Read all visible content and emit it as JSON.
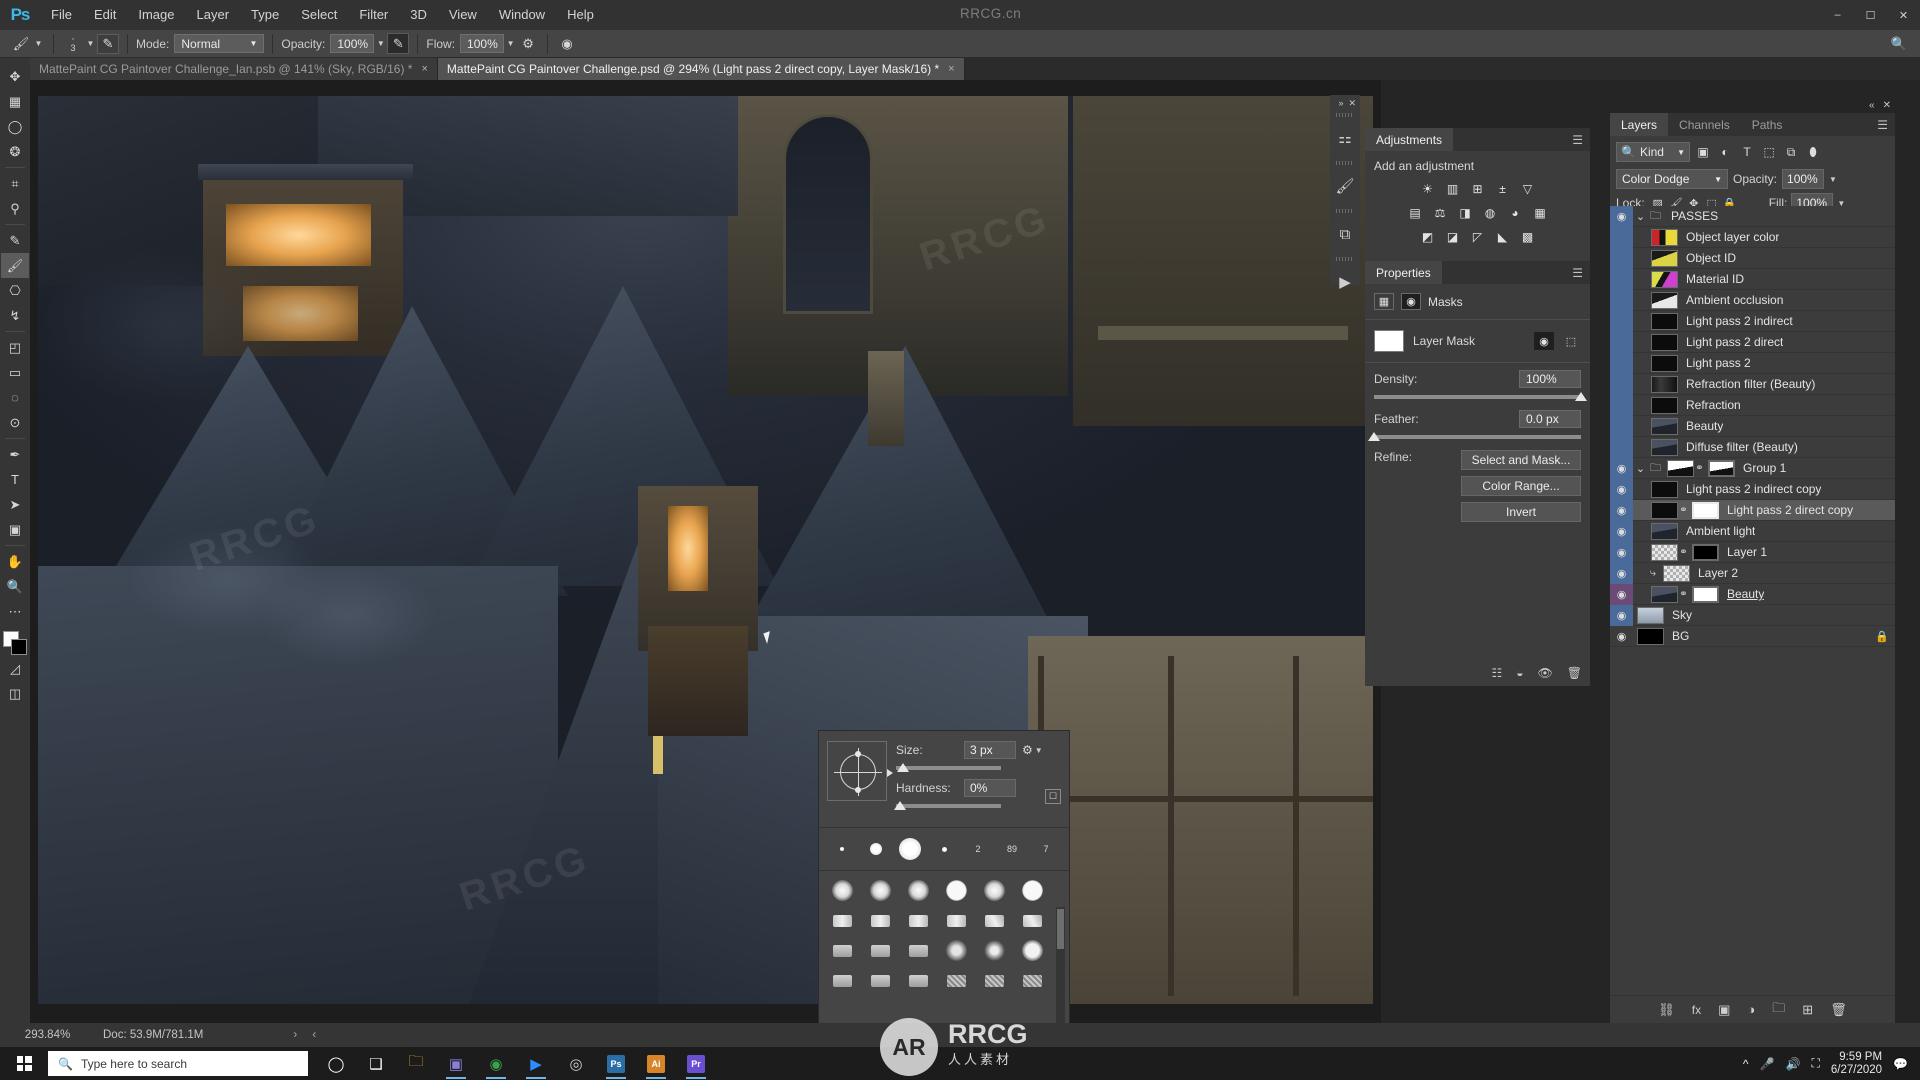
{
  "app": {
    "name": "Ps",
    "watermark_top": "RRCG.cn",
    "watermark_canvas": "RRCG",
    "watermark_badge": "AR",
    "watermark_center": "RRCG",
    "watermark_center_sub": "人人素材"
  },
  "menubar": {
    "items": [
      "File",
      "Edit",
      "Image",
      "Layer",
      "Type",
      "Select",
      "Filter",
      "3D",
      "View",
      "Window",
      "Help"
    ],
    "window_buttons": [
      "minimize",
      "maximize",
      "close"
    ]
  },
  "options_bar": {
    "brush_caret": "chevron-down",
    "brush_size_value": "3",
    "toggle_icon": "brush-panel-icon",
    "mode_label": "Mode:",
    "mode_value": "Normal",
    "opacity_label": "Opacity:",
    "opacity_value": "100%",
    "airbrush_icon": "airbrush-icon",
    "flow_label": "Flow:",
    "flow_value": "100%",
    "smoothing_icon": "smoothing-icon",
    "tablet_icon": "pressure-icon",
    "search_icon": "search-icon"
  },
  "tabs": [
    {
      "label": "MattePaint CG Paintover Challenge_Ian.psb @ 141% (Sky, RGB/16) *",
      "active": false,
      "close": "×"
    },
    {
      "label": "MattePaint CG Paintover Challenge.psd @ 294% (Light pass 2 direct copy, Layer Mask/16) *",
      "active": true,
      "close": "×"
    }
  ],
  "toolbar": {
    "tools": [
      {
        "name": "move-tool",
        "glyph": "✥",
        "active": false
      },
      {
        "name": "rectangular-marquee-tool",
        "glyph": "▦",
        "active": false
      },
      {
        "name": "lasso-tool",
        "glyph": "◯",
        "active": false
      },
      {
        "name": "quick-selection-tool",
        "glyph": "❂",
        "active": false
      },
      {
        "name": "crop-tool",
        "glyph": "⌗",
        "active": false
      },
      {
        "name": "eyedropper-tool",
        "glyph": "⚲",
        "active": false
      },
      {
        "name": "spot-healing-brush-tool",
        "glyph": "✎",
        "active": false
      },
      {
        "name": "brush-tool",
        "glyph": "🖌",
        "active": true
      },
      {
        "name": "clone-stamp-tool",
        "glyph": "⎔",
        "active": false
      },
      {
        "name": "history-brush-tool",
        "glyph": "↯",
        "active": false
      },
      {
        "name": "eraser-tool",
        "glyph": "◰",
        "active": false
      },
      {
        "name": "gradient-tool",
        "glyph": "▭",
        "active": false
      },
      {
        "name": "blur-tool",
        "glyph": "◌",
        "active": false
      },
      {
        "name": "dodge-tool",
        "glyph": "⊙",
        "active": false
      },
      {
        "name": "pen-tool",
        "glyph": "✒",
        "active": false
      },
      {
        "name": "type-tool",
        "glyph": "T",
        "active": false
      },
      {
        "name": "path-selection-tool",
        "glyph": "➤",
        "active": false
      },
      {
        "name": "rectangle-tool",
        "glyph": "▣",
        "active": false
      },
      {
        "name": "hand-tool",
        "glyph": "✋",
        "active": false
      },
      {
        "name": "zoom-tool",
        "glyph": "🔍",
        "active": false
      },
      {
        "name": "edit-toolbar-tool",
        "glyph": "⋯",
        "active": false
      }
    ],
    "extra": [
      {
        "name": "quick-mask-toggle",
        "glyph": "◱"
      },
      {
        "name": "screen-mode-toggle",
        "glyph": "⬓"
      }
    ],
    "foreground_color": "#ffffff",
    "background_color": "#000000"
  },
  "dock_strip": {
    "collapse_icon": "collapse-icon",
    "close_icon": "close-icon",
    "buttons": [
      {
        "name": "adjustments-dock-icon",
        "glyph": "⚏"
      },
      {
        "name": "brushes-dock-icon",
        "glyph": "🖌"
      },
      {
        "name": "libraries-dock-icon",
        "glyph": "⧉"
      },
      {
        "name": "timeline-play-icon",
        "glyph": "▶"
      }
    ]
  },
  "adjustments_panel": {
    "tab": "Adjustments",
    "title": "Add an adjustment",
    "menu_icon": "panel-menu-icon",
    "row1": [
      {
        "name": "brightness-contrast-icon",
        "glyph": "☀"
      },
      {
        "name": "levels-icon",
        "glyph": "▥"
      },
      {
        "name": "curves-icon",
        "glyph": "⊞"
      },
      {
        "name": "exposure-icon",
        "glyph": "±"
      },
      {
        "name": "vibrance-icon",
        "glyph": "▽"
      }
    ],
    "row2": [
      {
        "name": "hue-saturation-icon",
        "glyph": "▤"
      },
      {
        "name": "color-balance-icon",
        "glyph": "⚖"
      },
      {
        "name": "black-white-icon",
        "glyph": "◨"
      },
      {
        "name": "photo-filter-icon",
        "glyph": "◍"
      },
      {
        "name": "channel-mixer-icon",
        "glyph": "◕"
      },
      {
        "name": "color-lookup-icon",
        "glyph": "▦"
      }
    ],
    "row3": [
      {
        "name": "invert-icon",
        "glyph": "◩"
      },
      {
        "name": "posterize-icon",
        "glyph": "◪"
      },
      {
        "name": "threshold-icon",
        "glyph": "◸"
      },
      {
        "name": "selective-color-icon",
        "glyph": "◣"
      },
      {
        "name": "gradient-map-icon",
        "glyph": "▩"
      }
    ]
  },
  "properties_panel": {
    "tab": "Properties",
    "menu_icon": "panel-menu-icon",
    "mode_icons": [
      {
        "name": "pixel-mask-icon",
        "glyph": "▨",
        "selected": false
      },
      {
        "name": "vector-mask-icon",
        "glyph": "◉",
        "selected": true
      }
    ],
    "section_title": "Masks",
    "mask_label": "Layer Mask",
    "mask_buttons": [
      {
        "name": "select-pixel-mask-icon",
        "glyph": "◉"
      },
      {
        "name": "add-vector-mask-icon",
        "glyph": "⬚"
      }
    ],
    "density_label": "Density:",
    "density_value": "100%",
    "density_pct": 100,
    "feather_label": "Feather:",
    "feather_value": "0.0 px",
    "feather_pct": 0,
    "refine_label": "Refine:",
    "buttons": [
      "Select and Mask...",
      "Color Range...",
      "Invert"
    ],
    "footer_icons": [
      {
        "name": "load-selection-icon",
        "glyph": "⣿"
      },
      {
        "name": "apply-mask-icon",
        "glyph": "◒"
      },
      {
        "name": "toggle-mask-icon",
        "glyph": "👁"
      },
      {
        "name": "delete-mask-icon",
        "glyph": "🗑"
      }
    ]
  },
  "layers_panel": {
    "tabs": [
      {
        "label": "Layers",
        "active": true
      },
      {
        "label": "Channels",
        "active": false
      },
      {
        "label": "Paths",
        "active": false
      }
    ],
    "menu_icon": "panel-menu-icon",
    "collapse_icon": "collapse-icon",
    "close_icon": "close-icon",
    "filter": {
      "kind_label": "Kind",
      "search_icon": "search-icon",
      "caret": "chevron-down",
      "icons": [
        {
          "name": "filter-pixel-icon",
          "glyph": "▣"
        },
        {
          "name": "filter-adjustment-icon",
          "glyph": "◐"
        },
        {
          "name": "filter-type-icon",
          "glyph": "T"
        },
        {
          "name": "filter-shape-icon",
          "glyph": "⬚"
        },
        {
          "name": "filter-smart-object-icon",
          "glyph": "⧉"
        },
        {
          "name": "filter-toggle-icon",
          "glyph": "⬮"
        }
      ]
    },
    "blend_mode": "Color Dodge",
    "opacity_label": "Opacity:",
    "opacity_value": "100%",
    "lock_label": "Lock:",
    "lock_icons": [
      {
        "name": "lock-transparent-pixels-icon",
        "glyph": "▨"
      },
      {
        "name": "lock-image-pixels-icon",
        "glyph": "🖌"
      },
      {
        "name": "lock-position-icon",
        "glyph": "✥"
      },
      {
        "name": "lock-artboard-nesting-icon",
        "glyph": "⬚"
      },
      {
        "name": "lock-all-icon",
        "glyph": "🔒"
      }
    ],
    "fill_label": "Fill:",
    "fill_value": "100%",
    "layers": [
      {
        "name": "PASSES",
        "visible": true,
        "type": "group",
        "expanded": true,
        "indent": 0,
        "thumb": "folder",
        "selected": false
      },
      {
        "name": "Object layer color",
        "visible": false,
        "type": "layer",
        "indent": 1,
        "thumb": "art-colorful",
        "selected": false
      },
      {
        "name": "Object ID",
        "visible": false,
        "type": "layer",
        "indent": 1,
        "thumb": "art-yellow",
        "selected": false
      },
      {
        "name": "Material ID",
        "visible": false,
        "type": "layer",
        "indent": 1,
        "thumb": "art-magenta",
        "selected": false
      },
      {
        "name": "Ambient occlusion",
        "visible": false,
        "type": "layer",
        "indent": 1,
        "thumb": "art-white",
        "selected": false
      },
      {
        "name": "Light pass 2 indirect",
        "visible": false,
        "type": "layer",
        "indent": 1,
        "thumb": "art-black",
        "selected": false
      },
      {
        "name": "Light pass 2 direct",
        "visible": false,
        "type": "layer",
        "indent": 1,
        "thumb": "art-black",
        "selected": false
      },
      {
        "name": "Light pass 2",
        "visible": false,
        "type": "layer",
        "indent": 1,
        "thumb": "art-black",
        "selected": false
      },
      {
        "name": "Refraction filter (Beauty)",
        "visible": false,
        "type": "layer",
        "indent": 1,
        "thumb": "art-dark",
        "selected": false
      },
      {
        "name": "Refraction",
        "visible": false,
        "type": "layer",
        "indent": 1,
        "thumb": "art-black",
        "selected": false
      },
      {
        "name": "Beauty",
        "visible": false,
        "type": "layer",
        "indent": 1,
        "thumb": "art-scene",
        "selected": false
      },
      {
        "name": "Diffuse filter (Beauty)",
        "visible": false,
        "type": "layer",
        "indent": 1,
        "thumb": "art-scene",
        "selected": false
      },
      {
        "name": "Group 1",
        "visible": true,
        "type": "group",
        "expanded": true,
        "indent": 0,
        "thumb": "folder",
        "mask": "art-mask",
        "linked": true,
        "selected": false
      },
      {
        "name": "Light pass 2 indirect copy",
        "visible": true,
        "type": "layer",
        "indent": 1,
        "thumb": "art-black",
        "selected": false
      },
      {
        "name": "Light pass 2 direct copy",
        "visible": true,
        "type": "layer",
        "indent": 1,
        "thumb": "art-black",
        "mask": "white",
        "linked": true,
        "selected": true,
        "mask_active": true
      },
      {
        "name": "Ambient light",
        "visible": true,
        "type": "layer",
        "indent": 1,
        "thumb": "art-scene",
        "selected": false
      },
      {
        "name": "Layer 1",
        "visible": true,
        "type": "layer",
        "indent": 1,
        "thumb": "checker",
        "mask": "black",
        "linked": true,
        "selected": false
      },
      {
        "name": "Layer 2",
        "visible": true,
        "type": "layer",
        "indent": 1,
        "thumb": "checker",
        "clipped": true,
        "selected": false
      },
      {
        "name": "Beauty",
        "visible": true,
        "type": "layer",
        "indent": 1,
        "thumb": "art-scene-alpha",
        "mask": "white",
        "linked": true,
        "selected": false,
        "highlight": "magenta",
        "underline": true
      },
      {
        "name": "Sky",
        "visible": true,
        "type": "layer",
        "indent": 0,
        "thumb": "art-sky",
        "selected": false
      },
      {
        "name": "BG",
        "visible": true,
        "type": "layer",
        "indent": 0,
        "thumb": "black",
        "locked": true,
        "selected": false
      }
    ],
    "footer_icons": [
      {
        "name": "link-layers-icon",
        "glyph": "⛓"
      },
      {
        "name": "layer-style-icon",
        "glyph": "fx"
      },
      {
        "name": "add-layer-mask-icon",
        "glyph": "▣"
      },
      {
        "name": "new-fill-adjustment-icon",
        "glyph": "◑"
      },
      {
        "name": "new-group-icon",
        "glyph": "🗀"
      },
      {
        "name": "new-layer-icon",
        "glyph": "⊞"
      },
      {
        "name": "delete-layer-icon",
        "glyph": "🗑"
      }
    ]
  },
  "brush_popup": {
    "size_label": "Size:",
    "size_value": "3 px",
    "size_pct": 3,
    "hardness_label": "Hardness:",
    "hardness_value": "0%",
    "hardness_pct": 0,
    "gear_icon": "gear-icon",
    "new_preset_icon": "new-preset-icon",
    "preset_row": [
      {
        "name": "brush-preset-1",
        "size": "",
        "dot": 4
      },
      {
        "name": "brush-preset-2",
        "size": "",
        "dot": 12
      },
      {
        "name": "brush-preset-3",
        "size": "",
        "dot": 22
      },
      {
        "name": "brush-preset-4",
        "size": "",
        "dot": 5
      },
      {
        "name": "brush-preset-5",
        "size": "2",
        "dot": 0
      },
      {
        "name": "brush-preset-6",
        "size": "89",
        "dot": 0
      },
      {
        "name": "brush-preset-7",
        "size": "7",
        "dot": 0
      }
    ],
    "grid_rows": [
      [
        "soft-round-brush",
        "soft-round-brush",
        "soft-round-brush",
        "hard-round-brush",
        "soft-round-brush",
        "hard-round-brush"
      ],
      [
        "flat-brush",
        "flat-brush",
        "flat-brush",
        "flat-brush",
        "angled-brush",
        "angled-brush"
      ],
      [
        "square-brush",
        "square-brush",
        "square-brush",
        "chalk-brush",
        "round-blur-brush",
        "round-brush"
      ],
      [
        "square-brush",
        "square-brush",
        "square-brush",
        "texture-brush",
        "texture-brush",
        "texture-brush"
      ]
    ]
  },
  "status_bar": {
    "zoom": "293.84%",
    "doc_label": "Doc:",
    "doc_value": "53.9M/781.1M",
    "arrows": "› ‹"
  },
  "taskbar": {
    "search_placeholder": "Type here to search",
    "search_icon": "search-icon",
    "start_icon": "windows-start-icon",
    "apps": [
      {
        "name": "cortana-icon",
        "glyph": "◯",
        "color": "#ffffff",
        "active": false
      },
      {
        "name": "task-view-icon",
        "glyph": "❑",
        "color": "#ffffff",
        "active": false
      },
      {
        "name": "file-explorer-icon",
        "glyph": "🗀",
        "color": "#f0b429",
        "active": false
      },
      {
        "name": "photos-icon",
        "glyph": "▣",
        "color": "#8a7fd6",
        "active": true
      },
      {
        "name": "chrome-icon",
        "glyph": "◉",
        "color": "#3ca14f",
        "active": true
      },
      {
        "name": "zoom-icon",
        "glyph": "▶",
        "color": "#2d8cff",
        "active": true
      },
      {
        "name": "media-player-icon",
        "glyph": "◎",
        "color": "#cfcfcf",
        "active": false
      },
      {
        "name": "photoshop-icon",
        "glyph": "Ps",
        "color": "#2b6ea5",
        "active": true
      },
      {
        "name": "illustrator-icon",
        "glyph": "Ai",
        "color": "#d6852a",
        "active": true
      },
      {
        "name": "premiere-icon",
        "glyph": "Pr",
        "color": "#6c4fd0",
        "active": true
      }
    ],
    "tray": [
      {
        "name": "show-hidden-icons-icon",
        "glyph": "⌃"
      },
      {
        "name": "microphone-icon",
        "glyph": "🎤"
      },
      {
        "name": "volume-icon",
        "glyph": "🔊"
      },
      {
        "name": "network-icon",
        "glyph": "🖧"
      }
    ],
    "time": "9:59 PM",
    "date": "6/27/2020",
    "notification_icon": "notification-icon"
  }
}
